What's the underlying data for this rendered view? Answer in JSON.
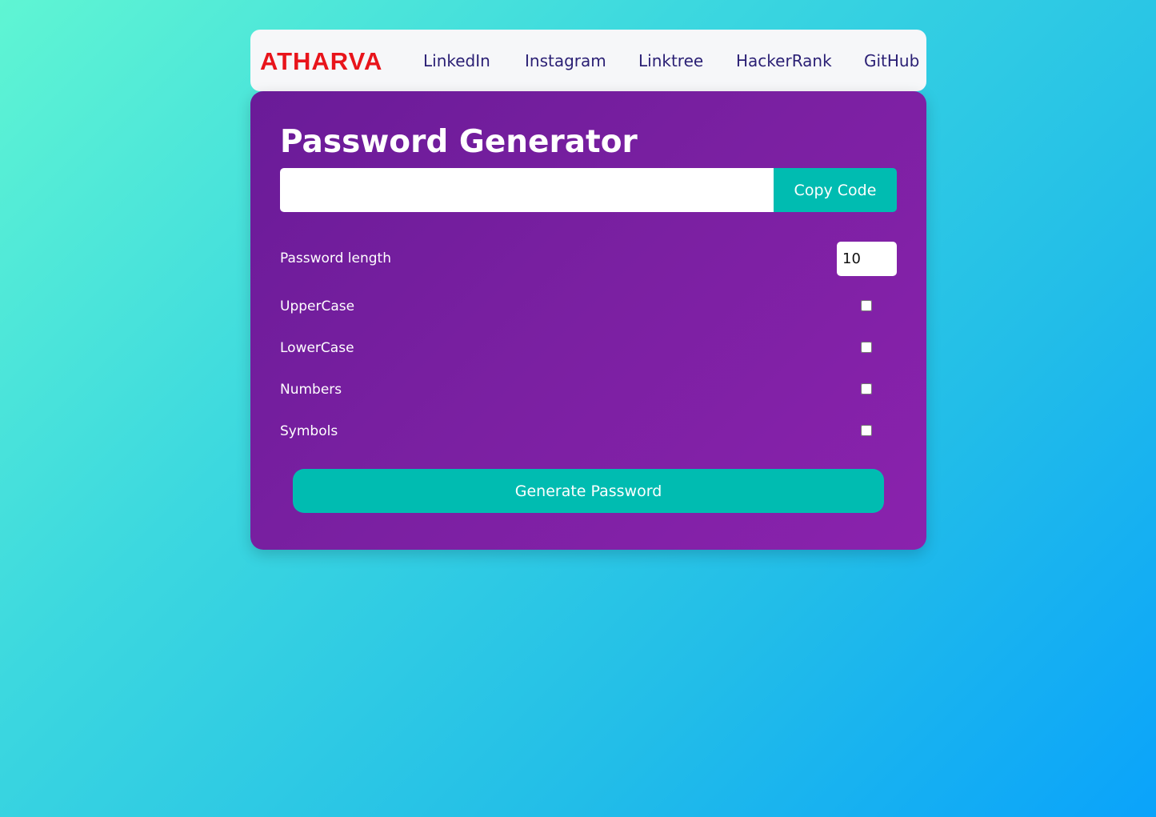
{
  "navbar": {
    "brand": "ATHARVA",
    "links": [
      {
        "label": "LinkedIn"
      },
      {
        "label": "Instagram"
      },
      {
        "label": "Linktree"
      },
      {
        "label": "HackerRank"
      },
      {
        "label": "GitHub"
      }
    ]
  },
  "generator": {
    "title": "Password Generator",
    "password_value": "",
    "copy_label": "Copy Code",
    "length_label": "Password length",
    "length_value": "10",
    "options": [
      {
        "label": "UpperCase",
        "checked": false
      },
      {
        "label": "LowerCase",
        "checked": false
      },
      {
        "label": "Numbers",
        "checked": false
      },
      {
        "label": "Symbols",
        "checked": false
      }
    ],
    "generate_label": "Generate Password"
  },
  "colors": {
    "brand": "#e8141b",
    "nav_link": "#2a1f74",
    "card": "#7b20a2",
    "accent": "#00bcb1"
  }
}
